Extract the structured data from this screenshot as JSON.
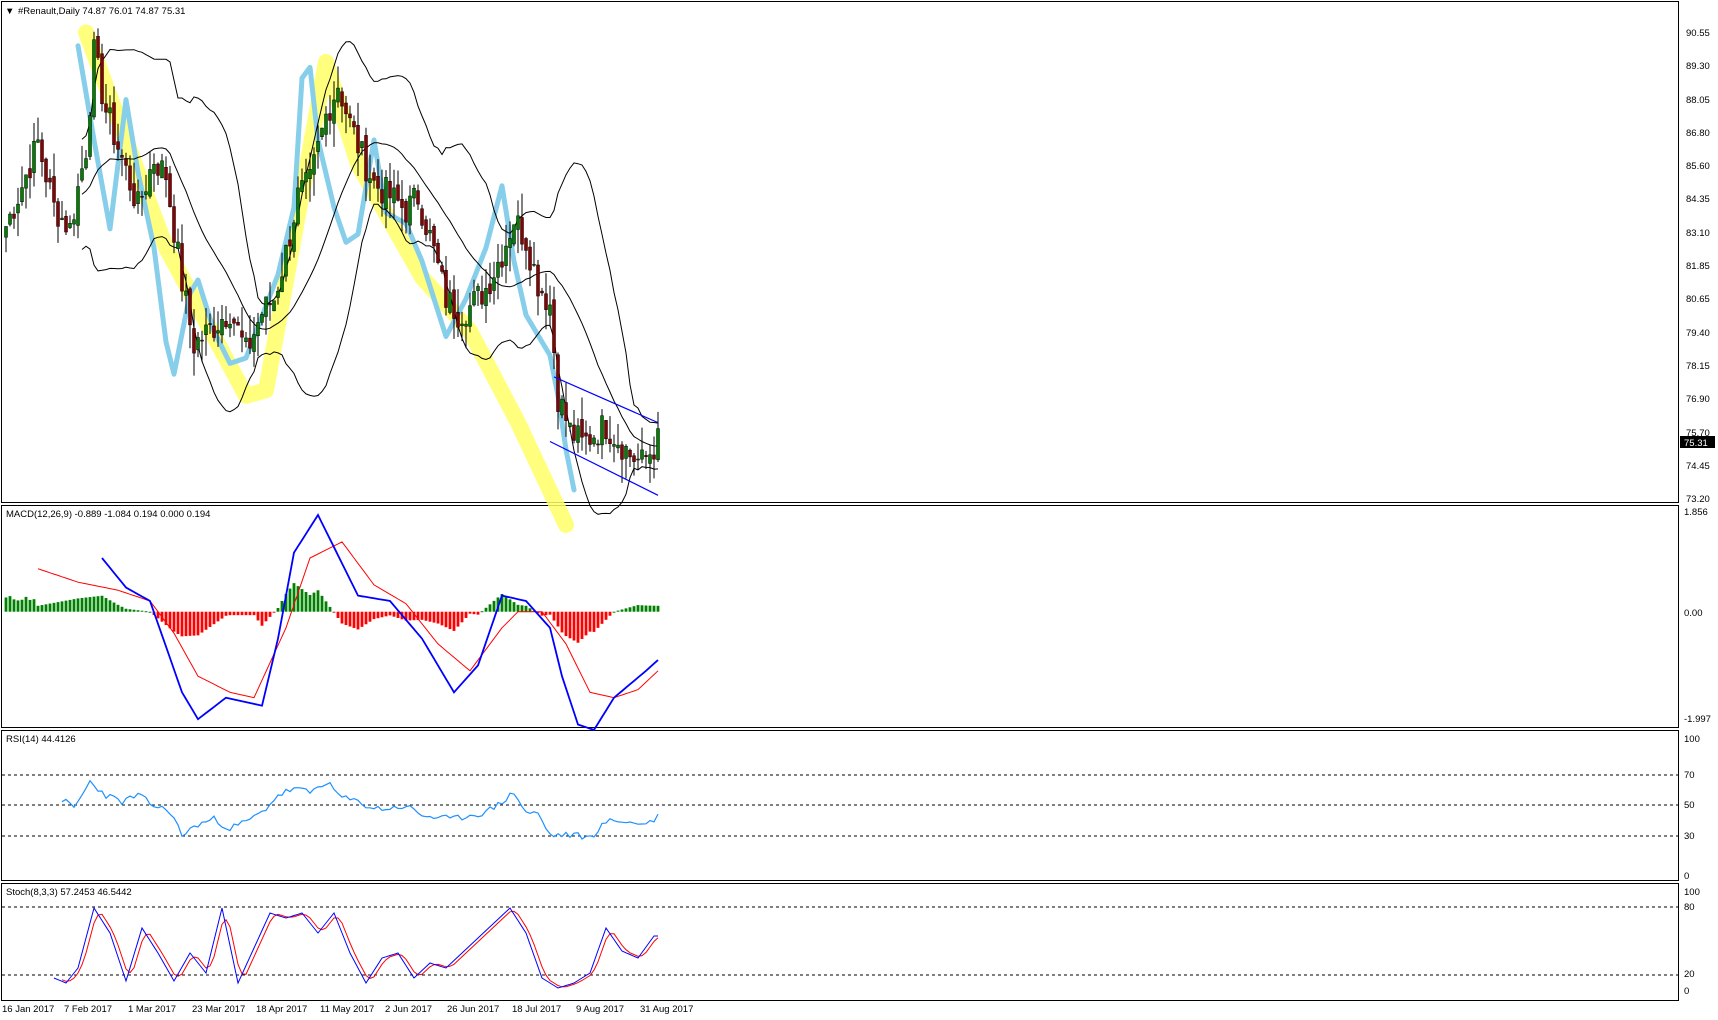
{
  "colors": {
    "background": "#ffffff",
    "grid": "#000000",
    "bull_body": "#008000",
    "bear_body": "#8b0000",
    "wick": "#000000",
    "bollinger": "#000000",
    "yellow_highlight": "#ffff66",
    "cyan_highlight": "#87ceeb",
    "channel": "#0000ff",
    "macd_line": "#0000ff",
    "signal_line": "#ff0000",
    "hist_pos": "#008000",
    "hist_neg": "#ff0000",
    "rsi_line": "#1e90ff",
    "stoch_main": "#0000ff",
    "stoch_signal": "#ff0000",
    "price_badge_bg": "#000000",
    "price_badge_text": "#ffffff"
  },
  "main": {
    "title_arrow": "▼",
    "title": "#Renault,Daily  74.87 76.01 74.87 75.31",
    "current_price": "75.31",
    "y_labels": [
      "90.55",
      "89.30",
      "88.05",
      "86.80",
      "85.60",
      "84.35",
      "83.10",
      "81.85",
      "80.65",
      "79.40",
      "78.15",
      "76.90",
      "75.70",
      "74.45",
      "73.20"
    ]
  },
  "macd": {
    "title": "MACD(12,26,9) -0.889 -1.084 0.194 0.000 0.194",
    "y_labels": [
      "1.856",
      "0.00",
      "-1.997"
    ]
  },
  "rsi": {
    "title": "RSI(14) 44.4126",
    "y_labels": [
      "100",
      "70",
      "50",
      "30",
      "0"
    ]
  },
  "stoch": {
    "title": "Stoch(8,3,3) 57.2453 46.5442",
    "y_labels": [
      "100",
      "80",
      "20",
      "0"
    ]
  },
  "x_labels": [
    "16 Jan 2017",
    "7 Feb 2017",
    "1 Mar 2017",
    "23 Mar 2017",
    "18 Apr 2017",
    "11 May 2017",
    "2 Jun 2017",
    "26 Jun 2017",
    "18 Jul 2017",
    "9 Aug 2017",
    "31 Aug 2017"
  ],
  "chart_data": [
    {
      "type": "candlestick",
      "title": "#Renault,Daily",
      "ylim": [
        73.2,
        90.55
      ],
      "grid": false,
      "close_anchors": [
        [
          0,
          83.3
        ],
        [
          4,
          84.8
        ],
        [
          8,
          86.4
        ],
        [
          12,
          84.0
        ],
        [
          16,
          83.2
        ],
        [
          20,
          86.2
        ],
        [
          22,
          89.7
        ],
        [
          25,
          87.6
        ],
        [
          29,
          85.8
        ],
        [
          33,
          84.0
        ],
        [
          37,
          85.8
        ],
        [
          40,
          85.2
        ],
        [
          44,
          81.2
        ],
        [
          47,
          78.9
        ],
        [
          52,
          79.6
        ],
        [
          56,
          80.2
        ],
        [
          60,
          78.6
        ],
        [
          64,
          80.1
        ],
        [
          67,
          80.6
        ],
        [
          70,
          82.3
        ],
        [
          73,
          84.4
        ],
        [
          76,
          84.9
        ],
        [
          80,
          87.4
        ],
        [
          83,
          88.6
        ],
        [
          86,
          87.1
        ],
        [
          89,
          85.9
        ],
        [
          92,
          84.9
        ],
        [
          96,
          84.4
        ],
        [
          100,
          83.9
        ],
        [
          103,
          84.4
        ],
        [
          106,
          82.9
        ],
        [
          110,
          80.6
        ],
        [
          113,
          80.1
        ],
        [
          116,
          80.3
        ],
        [
          120,
          81.0
        ],
        [
          124,
          82.3
        ],
        [
          127,
          83.6
        ],
        [
          130,
          82.8
        ],
        [
          133,
          81.2
        ],
        [
          136,
          80.4
        ],
        [
          138,
          77.0
        ],
        [
          141,
          75.7
        ],
        [
          144,
          75.2
        ],
        [
          147,
          75.6
        ],
        [
          150,
          75.9
        ],
        [
          153,
          75.4
        ],
        [
          156,
          74.8
        ],
        [
          159,
          74.5
        ],
        [
          163,
          75.3
        ]
      ]
    },
    {
      "type": "bar+line",
      "title": "MACD(12,26,9)",
      "ylim": [
        -1.997,
        1.856
      ],
      "series": [
        "macd",
        "signal",
        "histogram"
      ],
      "macd_anchors": [
        [
          24,
          1.0
        ],
        [
          30,
          0.45
        ],
        [
          36,
          0.2
        ],
        [
          44,
          -1.5
        ],
        [
          48,
          -2.0
        ],
        [
          55,
          -1.6
        ],
        [
          64,
          -1.75
        ],
        [
          68,
          -0.5
        ],
        [
          72,
          1.1
        ],
        [
          78,
          1.8
        ],
        [
          82,
          1.2
        ],
        [
          88,
          0.3
        ],
        [
          96,
          0.2
        ],
        [
          104,
          -0.5
        ],
        [
          112,
          -1.5
        ],
        [
          118,
          -1.0
        ],
        [
          124,
          0.3
        ],
        [
          130,
          0.2
        ],
        [
          136,
          -0.3
        ],
        [
          139,
          -1.2
        ],
        [
          143,
          -2.1
        ],
        [
          147,
          -2.2
        ],
        [
          152,
          -1.6
        ],
        [
          160,
          -1.1
        ],
        [
          163,
          -0.9
        ]
      ],
      "signal_anchors": [
        [
          8,
          0.8
        ],
        [
          18,
          0.55
        ],
        [
          28,
          0.4
        ],
        [
          36,
          0.2
        ],
        [
          42,
          -0.4
        ],
        [
          48,
          -1.2
        ],
        [
          56,
          -1.5
        ],
        [
          62,
          -1.6
        ],
        [
          70,
          -0.3
        ],
        [
          76,
          1.0
        ],
        [
          84,
          1.3
        ],
        [
          92,
          0.5
        ],
        [
          100,
          0.15
        ],
        [
          108,
          -0.6
        ],
        [
          116,
          -1.1
        ],
        [
          124,
          -0.3
        ],
        [
          128,
          0.0
        ],
        [
          134,
          0.0
        ],
        [
          140,
          -0.6
        ],
        [
          146,
          -1.5
        ],
        [
          152,
          -1.6
        ],
        [
          158,
          -1.45
        ],
        [
          163,
          -1.1
        ]
      ]
    },
    {
      "type": "line",
      "title": "RSI(14) 44.4126",
      "ylim": [
        0,
        100
      ],
      "levels": [
        70,
        50,
        30
      ],
      "rsi_anchors": [
        [
          14,
          57
        ],
        [
          17,
          50
        ],
        [
          21,
          70
        ],
        [
          25,
          60
        ],
        [
          29,
          55
        ],
        [
          33,
          60
        ],
        [
          37,
          52
        ],
        [
          41,
          48
        ],
        [
          44,
          30
        ],
        [
          48,
          38
        ],
        [
          52,
          42
        ],
        [
          56,
          35
        ],
        [
          60,
          40
        ],
        [
          64,
          47
        ],
        [
          68,
          60
        ],
        [
          72,
          65
        ],
        [
          76,
          62
        ],
        [
          80,
          70
        ],
        [
          84,
          58
        ],
        [
          88,
          55
        ],
        [
          92,
          50
        ],
        [
          96,
          50
        ],
        [
          100,
          52
        ],
        [
          104,
          45
        ],
        [
          108,
          43
        ],
        [
          112,
          42
        ],
        [
          116,
          45
        ],
        [
          120,
          47
        ],
        [
          124,
          55
        ],
        [
          127,
          62
        ],
        [
          130,
          47
        ],
        [
          133,
          46
        ],
        [
          136,
          30
        ],
        [
          142,
          30
        ],
        [
          146,
          28
        ],
        [
          150,
          40
        ],
        [
          154,
          41
        ],
        [
          158,
          38
        ],
        [
          162,
          41
        ],
        [
          163,
          44
        ]
      ]
    },
    {
      "type": "line",
      "title": "Stoch(8,3,3) 57.2453 46.5442",
      "ylim": [
        0,
        100
      ],
      "levels": [
        80,
        20
      ],
      "stoch_anchors": [
        [
          12,
          15
        ],
        [
          15,
          10
        ],
        [
          18,
          25
        ],
        [
          22,
          85
        ],
        [
          26,
          60
        ],
        [
          30,
          12
        ],
        [
          34,
          65
        ],
        [
          38,
          40
        ],
        [
          42,
          12
        ],
        [
          46,
          40
        ],
        [
          50,
          20
        ],
        [
          54,
          85
        ],
        [
          58,
          10
        ],
        [
          62,
          45
        ],
        [
          66,
          80
        ],
        [
          70,
          75
        ],
        [
          74,
          80
        ],
        [
          78,
          60
        ],
        [
          82,
          80
        ],
        [
          86,
          40
        ],
        [
          90,
          10
        ],
        [
          94,
          35
        ],
        [
          98,
          40
        ],
        [
          102,
          15
        ],
        [
          106,
          30
        ],
        [
          110,
          25
        ],
        [
          114,
          40
        ],
        [
          118,
          55
        ],
        [
          122,
          70
        ],
        [
          126,
          85
        ],
        [
          130,
          60
        ],
        [
          134,
          15
        ],
        [
          138,
          5
        ],
        [
          142,
          10
        ],
        [
          146,
          20
        ],
        [
          150,
          65
        ],
        [
          154,
          42
        ],
        [
          158,
          35
        ],
        [
          162,
          57
        ],
        [
          163,
          57
        ]
      ]
    }
  ]
}
